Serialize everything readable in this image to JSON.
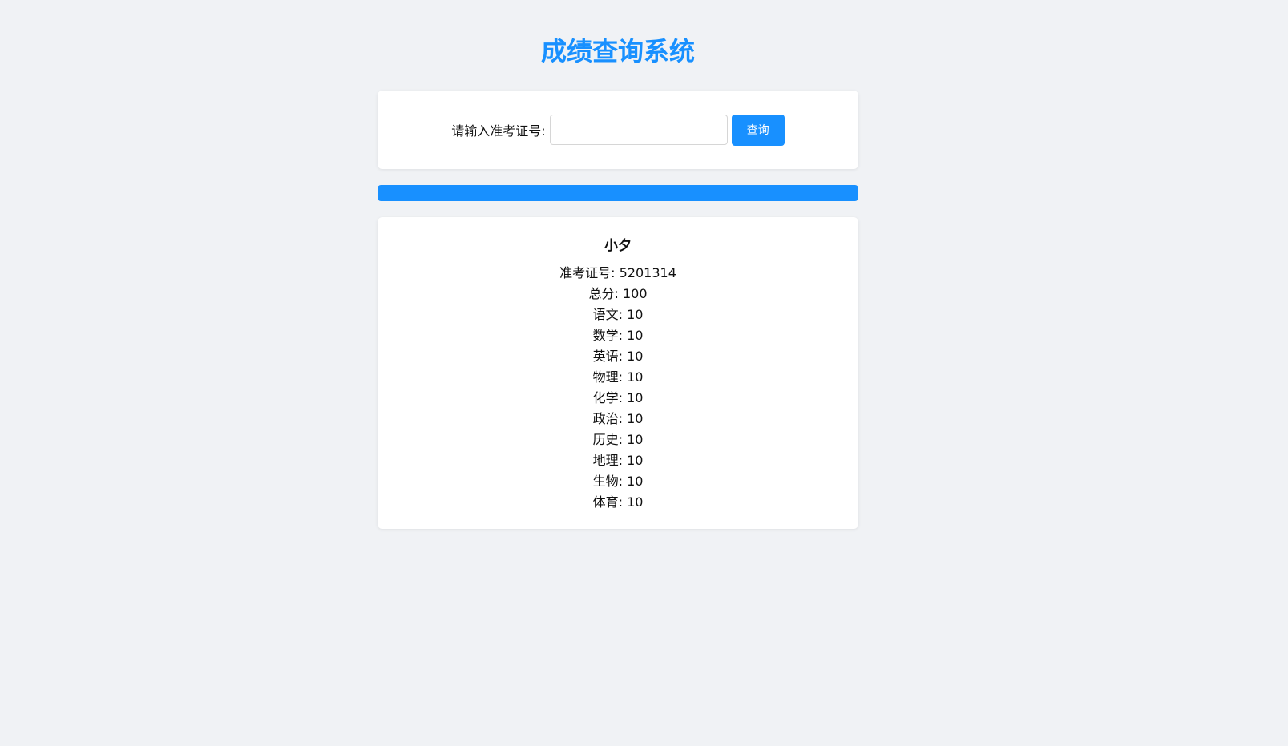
{
  "header": {
    "title": "成绩查询系统"
  },
  "search": {
    "label": "请输入准考证号:",
    "value": "",
    "placeholder": "",
    "button_label": "查询"
  },
  "progress": {
    "percent": 100,
    "color": "#1890ff"
  },
  "result": {
    "name": "小夕",
    "rows": [
      {
        "label": "准考证号",
        "value": "5201314"
      },
      {
        "label": "总分",
        "value": "100"
      },
      {
        "label": "语文",
        "value": "10"
      },
      {
        "label": "数学",
        "value": "10"
      },
      {
        "label": "英语",
        "value": "10"
      },
      {
        "label": "物理",
        "value": "10"
      },
      {
        "label": "化学",
        "value": "10"
      },
      {
        "label": "政治",
        "value": "10"
      },
      {
        "label": "历史",
        "value": "10"
      },
      {
        "label": "地理",
        "value": "10"
      },
      {
        "label": "生物",
        "value": "10"
      },
      {
        "label": "体育",
        "value": "10"
      }
    ]
  },
  "colors": {
    "accent": "#1890ff",
    "background": "#f0f2f5",
    "card": "#ffffff"
  }
}
